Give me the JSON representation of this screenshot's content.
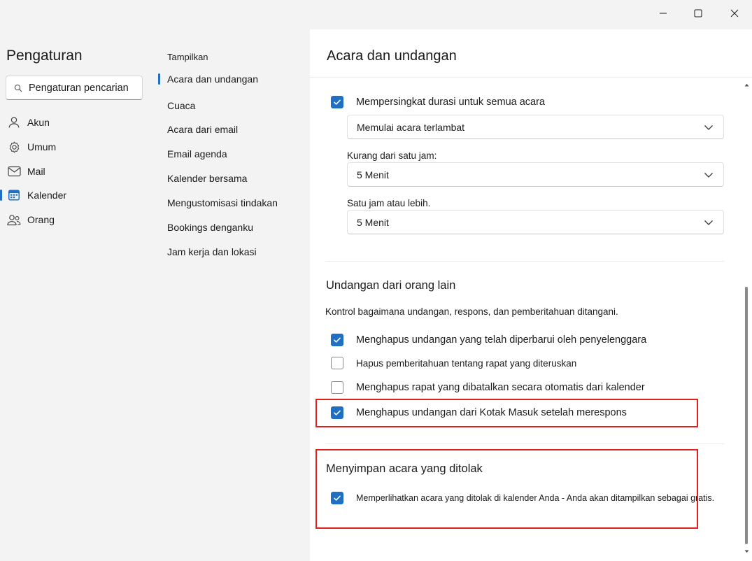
{
  "window": {
    "controls": [
      "minimize",
      "maximize",
      "close"
    ]
  },
  "nav": {
    "title": "Pengaturan",
    "search_placeholder": "Pengaturan pencarian",
    "items": [
      {
        "label": "Akun",
        "icon": "person-icon"
      },
      {
        "label": "Umum",
        "icon": "gear-icon"
      },
      {
        "label": "Mail",
        "icon": "mail-icon"
      },
      {
        "label": "Kalender",
        "icon": "calendar-icon",
        "selected": true
      },
      {
        "label": "Orang",
        "icon": "people-icon"
      }
    ]
  },
  "subnav": {
    "heading": "Tampilkan",
    "items": [
      {
        "label": "Acara dan undangan",
        "selected": true
      },
      {
        "label": "Cuaca"
      },
      {
        "label": "Acara dari email"
      },
      {
        "label": "Email agenda"
      },
      {
        "label": "Kalender bersama"
      },
      {
        "label": "Mengustomisasi tindakan"
      },
      {
        "label": "Bookings denganku"
      },
      {
        "label": "Jam kerja dan lokasi"
      }
    ]
  },
  "content": {
    "title": "Acara dan undangan",
    "shorten": {
      "label": "Mempersingkat durasi untuk semua acara",
      "checked": true,
      "mode_value": "Memulai acara terlambat",
      "less_than_hour_label": "Kurang dari satu jam:",
      "less_than_hour_value": "5 Menit",
      "hour_or_more_label": "Satu jam atau lebih.",
      "hour_or_more_value": "5 Menit"
    },
    "invitations": {
      "title": "Undangan dari orang lain",
      "description": "Kontrol bagaimana undangan, respons, dan pemberitahuan ditangani.",
      "options": [
        {
          "label": "Menghapus undangan yang telah diperbarui oleh penyelenggara",
          "checked": true
        },
        {
          "label": "Hapus pemberitahuan tentang rapat yang diteruskan",
          "checked": false
        },
        {
          "label": "Menghapus rapat yang dibatalkan secara otomatis dari kalender",
          "checked": false
        },
        {
          "label": "Menghapus undangan dari Kotak Masuk setelah merespons",
          "checked": true
        }
      ]
    },
    "declined": {
      "title": "Menyimpan acara yang ditolak",
      "option_label": "Memperlihatkan acara yang ditolak di kalender Anda - Anda akan ditampilkan sebagai gratis.",
      "checked": true
    }
  },
  "colors": {
    "accent": "#1f6fc5",
    "highlight": "#e0201b"
  }
}
